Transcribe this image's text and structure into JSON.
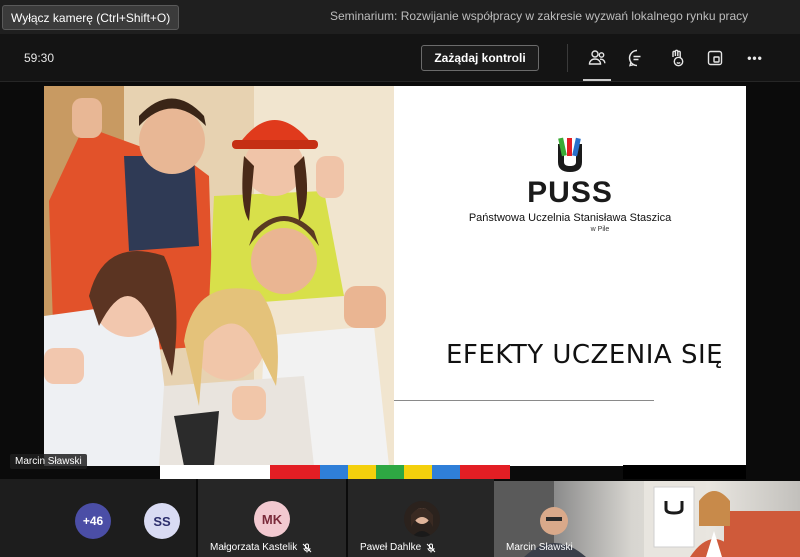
{
  "titlebar": {
    "tooltip": "Wyłącz kamerę (Ctrl+Shift+O)",
    "meeting_title": "Seminarium: Rozwijanie współpracy w zakresie wyzwań lokalnego rynku pracy"
  },
  "toolbar": {
    "timer": "59:30",
    "request_control_label": "Zażądaj kontroli",
    "icons": [
      "people-icon",
      "chat-icon",
      "reactions-icon",
      "share-tray-icon",
      "more-options-icon"
    ],
    "more_label": "•••"
  },
  "slide": {
    "logo_text": "PUSS",
    "university_name": "Państwowa Uczelnia Stanisława Staszica",
    "university_city": "w Pile",
    "heading": "EFEKTY UCZENIA  SIĘ",
    "presenter_label": "Marcin Sławski",
    "strip_colors": [
      "#ffffff",
      "#e31e24",
      "#2f7fd8",
      "#f4d00c",
      "#2ea843",
      "#f4d00c",
      "#2f7fd8",
      "#e31e24"
    ],
    "logo_colors": {
      "green": "#3aaa35",
      "red": "#e31e24",
      "blue": "#2a6fc9",
      "dark": "#1a1a1a"
    }
  },
  "participants": {
    "more_count": "+46",
    "ss_initials": "SS",
    "tiles": [
      {
        "initials": "MK",
        "name": "Małgorzata Kastelik",
        "muted": true
      },
      {
        "initials": "",
        "name": "Paweł Dahlke",
        "muted": true
      },
      {
        "initials": "",
        "name": "Marcin Sławski",
        "muted": false
      }
    ],
    "colors": {
      "more_bg": "#4b4ea6",
      "ss_bg": "#d9dbf3",
      "mk_bg": "#f2c9d0",
      "mk_text": "#7a2a3a"
    }
  }
}
